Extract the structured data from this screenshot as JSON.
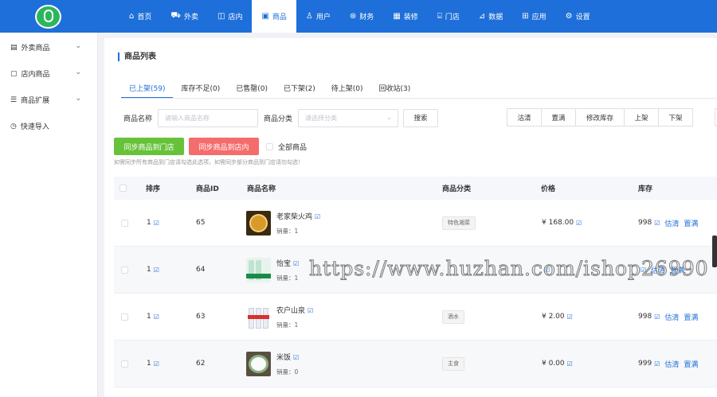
{
  "nav": {
    "items": [
      {
        "label": "首页",
        "icon": "home-icon",
        "glyph": "⌂"
      },
      {
        "label": "外卖",
        "icon": "delivery-icon",
        "glyph": "⛟"
      },
      {
        "label": "店内",
        "icon": "store-inside-icon",
        "glyph": "◫"
      },
      {
        "label": "商品",
        "icon": "goods-icon",
        "glyph": "▣"
      },
      {
        "label": "用户",
        "icon": "user-icon",
        "glyph": "♙"
      },
      {
        "label": "财务",
        "icon": "finance-icon",
        "glyph": "⊛"
      },
      {
        "label": "装修",
        "icon": "decoration-icon",
        "glyph": "▦"
      },
      {
        "label": "门店",
        "icon": "shop-icon",
        "glyph": "⌸"
      },
      {
        "label": "数据",
        "icon": "chart-icon",
        "glyph": "⊿"
      },
      {
        "label": "应用",
        "icon": "apps-icon",
        "glyph": "⊞"
      },
      {
        "label": "设置",
        "icon": "settings-icon",
        "glyph": "⚙"
      }
    ],
    "active_index": 3
  },
  "sidebar": {
    "items": [
      {
        "label": "外卖商品",
        "glyph": "▤",
        "chevron": "⌄"
      },
      {
        "label": "店内商品",
        "glyph": "▢",
        "chevron": "⌄"
      },
      {
        "label": "商品扩展",
        "glyph": "☰",
        "chevron": "⌄"
      },
      {
        "label": "快速导入",
        "glyph": "◷",
        "chevron": ""
      }
    ]
  },
  "page": {
    "title": "商品列表",
    "tabs": [
      "已上架(59)",
      "库存不足(0)",
      "已售罄(0)",
      "已下架(2)",
      "待上架(0)",
      "回收站(3)"
    ],
    "active_tab": 0
  },
  "filters": {
    "name_label": "商品名称",
    "name_placeholder": "请输入商品名称",
    "category_label": "商品分类",
    "category_placeholder": "请选择分类",
    "search_button": "搜索",
    "actions": [
      "沽清",
      "置满",
      "修改库存",
      "上架",
      "下架"
    ]
  },
  "sync": {
    "to_store": "同步商品到门店",
    "to_dinein": "同步商品到店内",
    "all_goods": "全部商品",
    "hint": "如需同步所有商品到门店请勾选此选项，如需同步部分商品到门店请勿勾选！"
  },
  "table": {
    "headers": [
      "排序",
      "商品ID",
      "商品名称",
      "商品分类",
      "价格",
      "库存"
    ],
    "edit_glyph": "☑",
    "sales_prefix": "销量：",
    "rows": [
      {
        "sort": "1",
        "id": "65",
        "name": "老家柴火鸡",
        "sales": "1",
        "category": "特色湘菜",
        "price": "¥ 168.00",
        "stock": "998",
        "act1": "估清",
        "act2": "置满"
      },
      {
        "sort": "1",
        "id": "64",
        "name": "怡宝",
        "sales": "1",
        "category": "",
        "price": "",
        "stock": "",
        "act1": "估清",
        "act2": "置满"
      },
      {
        "sort": "1",
        "id": "63",
        "name": "农户山泉",
        "sales": "1",
        "category": "酒水",
        "price": "¥ 2.00",
        "stock": "998",
        "act1": "估清",
        "act2": "置满"
      },
      {
        "sort": "1",
        "id": "62",
        "name": "米饭",
        "sales": "0",
        "category": "主食",
        "price": "¥ 0.00",
        "stock": "999",
        "act1": "估清",
        "act2": "置满"
      }
    ]
  },
  "watermark": "https://www.huzhan.com/ishop26990",
  "colors": {
    "primary": "#1e6fd9",
    "green": "#67c23a",
    "red": "#f56c6c"
  }
}
